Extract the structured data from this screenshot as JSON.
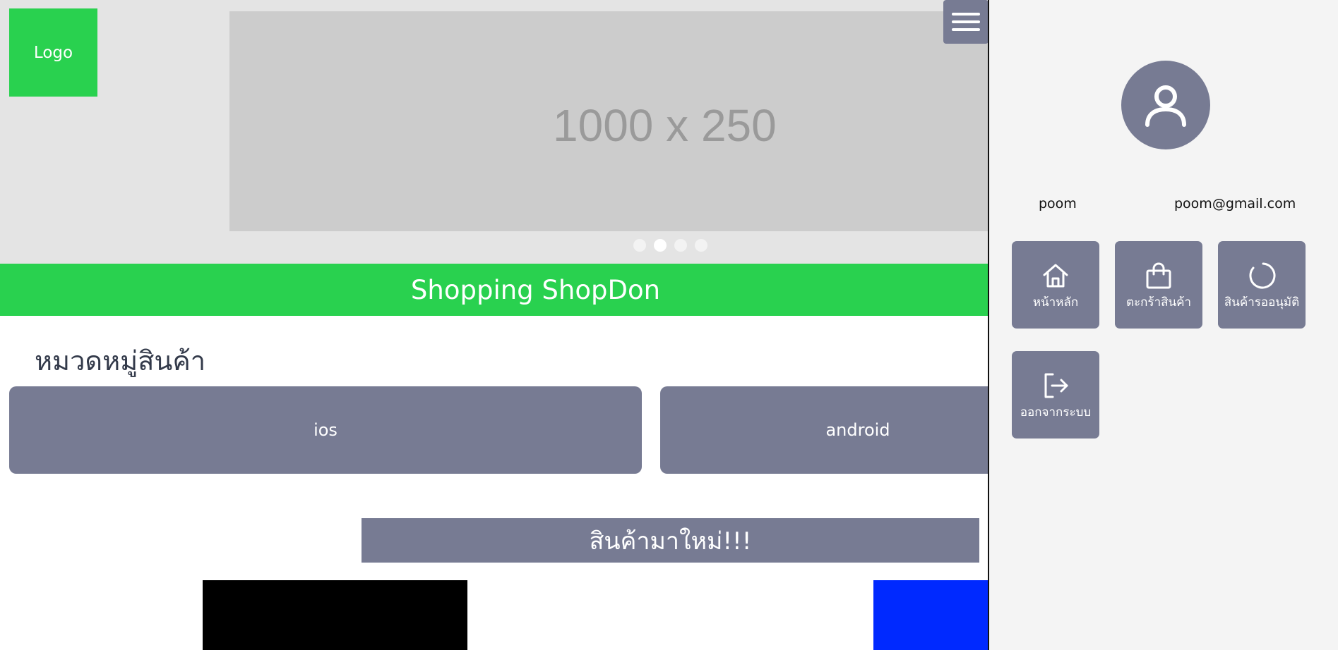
{
  "header": {
    "logo_label": "Logo",
    "banner_text": "1000 x 250",
    "carousel_dots": 4,
    "carousel_active": 2
  },
  "shop": {
    "title": "Shopping ShopDon"
  },
  "categories": {
    "title": "หมวดหมู่สินค้า",
    "items": [
      {
        "label": "ios"
      },
      {
        "label": "android"
      }
    ]
  },
  "new_products": {
    "title": "สินค้ามาใหม่!!!"
  },
  "side_panel": {
    "username": "poom",
    "email": "poom@gmail.com",
    "tiles": [
      {
        "label": "หน้าหลัก",
        "icon": "home-icon"
      },
      {
        "label": "ตะกร้าสินค้า",
        "icon": "shopping-bag-icon"
      },
      {
        "label": "สินค้ารออนุมัติ",
        "icon": "loading-icon"
      },
      {
        "label": "ออกจากระบบ",
        "icon": "logout-icon"
      }
    ]
  },
  "colors": {
    "brand_green": "#29d14f",
    "slate": "#777b93",
    "banner_gray": "#cccccc",
    "product_black": "#000000",
    "product_blue": "#0029ff"
  }
}
